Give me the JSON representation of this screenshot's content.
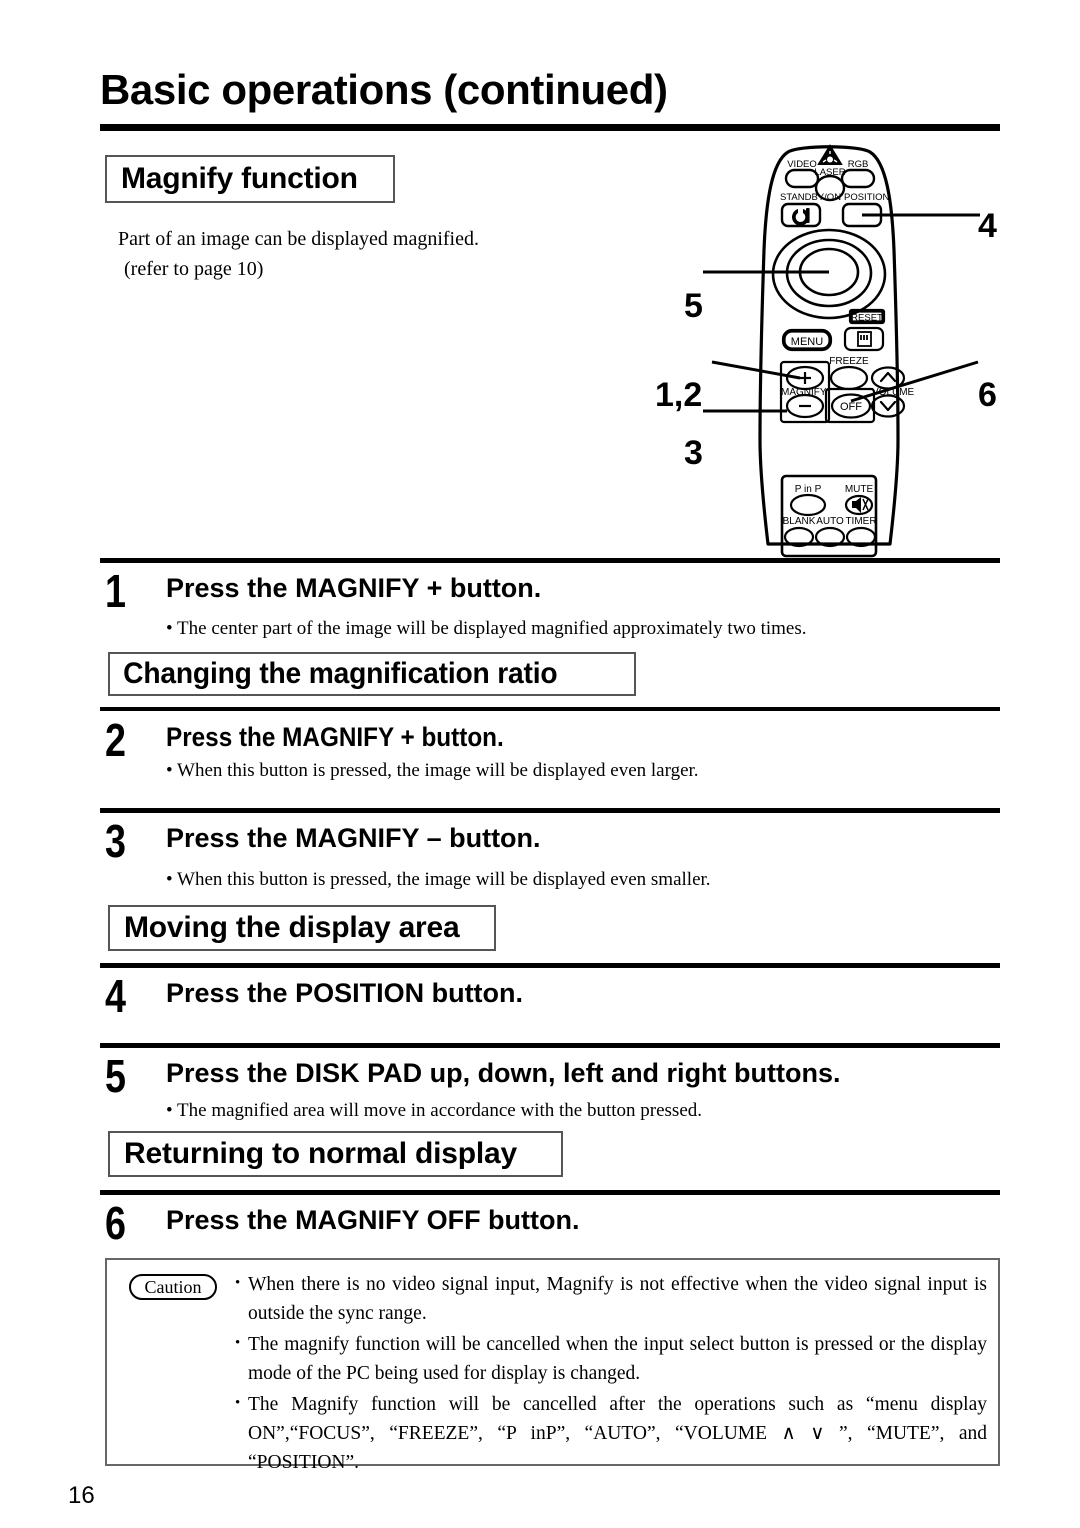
{
  "page": {
    "title": "Basic operations (continued)",
    "number": "16"
  },
  "sections": [
    {
      "id": "magnify-function",
      "label": "Magnify function"
    },
    {
      "id": "changing-ratio",
      "label": "Changing the magnification ratio"
    },
    {
      "id": "moving-display",
      "label": "Moving the display area"
    },
    {
      "id": "returning-normal",
      "label": "Returning to normal display"
    }
  ],
  "intro": {
    "line1": "Part of an image can be displayed magnified.",
    "line2": "(refer to page 10)"
  },
  "steps": [
    {
      "number": "1",
      "title": "Press the MAGNIFY + button.",
      "note": "• The center part of the image will be displayed magnified approximately two times."
    },
    {
      "number": "2",
      "title": "Press the MAGNIFY + button.",
      "note": "• When this button is pressed, the image will be displayed even larger."
    },
    {
      "number": "3",
      "title": "Press the MAGNIFY – button.",
      "note": "• When this button is pressed, the image will be displayed even smaller."
    },
    {
      "number": "4",
      "title": "Press the POSITION button.",
      "note": ""
    },
    {
      "number": "5",
      "title": "Press the DISK PAD up, down, left and right buttons.",
      "note": "• The magnified area will move in accordance with the button pressed."
    },
    {
      "number": "6",
      "title": "Press the MAGNIFY OFF button.",
      "note": ""
    }
  ],
  "caution": {
    "label": "Caution",
    "items": [
      "When there is no video signal input, Magnify is not effective when the video signal input is outside the sync range.",
      "The magnify function will be cancelled when the input select button is pressed or the display mode of the PC being used for display is changed.",
      "The Magnify function will be cancelled after the operations such as “menu display ON”,“FOCUS”, “FREEZE”,  “P inP”, “AUTO”, “VOLUME ∧ ∨ ”, “MUTE”, and “POSITION”."
    ]
  },
  "remote": {
    "callouts": [
      {
        "id": "callout-4",
        "label": "4"
      },
      {
        "id": "callout-5",
        "label": "5"
      },
      {
        "id": "callout-1-2",
        "label": "1,2"
      },
      {
        "id": "callout-3",
        "label": "3"
      },
      {
        "id": "callout-6",
        "label": "6"
      }
    ],
    "buttons": {
      "video": "VIDEO",
      "laser": "LASER",
      "rgb": "RGB",
      "standby_on": "STANDBY/ON",
      "position": "POSITION",
      "menu": "MENU",
      "reset": "RESET",
      "freeze": "FREEZE",
      "magnify": "MAGNIFY",
      "volume": "VOLUME",
      "magnify_plus": "+",
      "magnify_minus": "–",
      "magnify_off": "OFF",
      "p_in_p": "P in P",
      "mute": "MUTE",
      "blank": "BLANK",
      "auto": "AUTO",
      "timer": "TIMER"
    }
  }
}
